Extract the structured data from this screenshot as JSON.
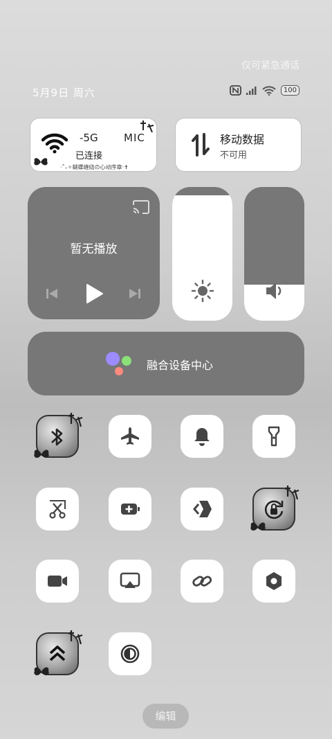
{
  "status_bar": {
    "emergency_text": "仅可紧急通话",
    "date": "5月9日 周六",
    "battery": "100",
    "icons": [
      "nfc-icon",
      "signal-icon",
      "wifi-icon",
      "battery-icon"
    ]
  },
  "wifi_card": {
    "name": "-5G",
    "ssid": "MIC",
    "status": "已连接",
    "caption": "·˚₊✧蝴蝶缠绕の心动序章·✝"
  },
  "mobile_card": {
    "name": "移动数据",
    "status": "不可用"
  },
  "media": {
    "title": "暂无播放"
  },
  "brightness": {
    "level": 0.94
  },
  "volume": {
    "level": 0.27
  },
  "device_center": {
    "label": "融合设备中心",
    "colors": [
      "#9c8cff",
      "#8ce07a",
      "#ff8a80"
    ]
  },
  "toggles": [
    {
      "icon": "bluetooth-icon",
      "active": true
    },
    {
      "icon": "airplane-icon",
      "active": false
    },
    {
      "icon": "bell-icon",
      "active": false
    },
    {
      "icon": "flashlight-icon",
      "active": false
    },
    {
      "icon": "screenshot-scissors-icon",
      "active": false
    },
    {
      "icon": "battery-saver-icon",
      "active": false
    },
    {
      "icon": "cast-arrow-icon",
      "active": false
    },
    {
      "icon": "rotation-lock-icon",
      "active": true
    },
    {
      "icon": "video-camera-icon",
      "active": false
    },
    {
      "icon": "screen-cast-icon",
      "active": false
    },
    {
      "icon": "link-icon",
      "active": false
    },
    {
      "icon": "settings-nut-icon",
      "active": false
    },
    {
      "icon": "double-chevron-up-icon",
      "active": true
    },
    {
      "icon": "contrast-icon",
      "active": false
    }
  ],
  "edit_button": "编辑"
}
